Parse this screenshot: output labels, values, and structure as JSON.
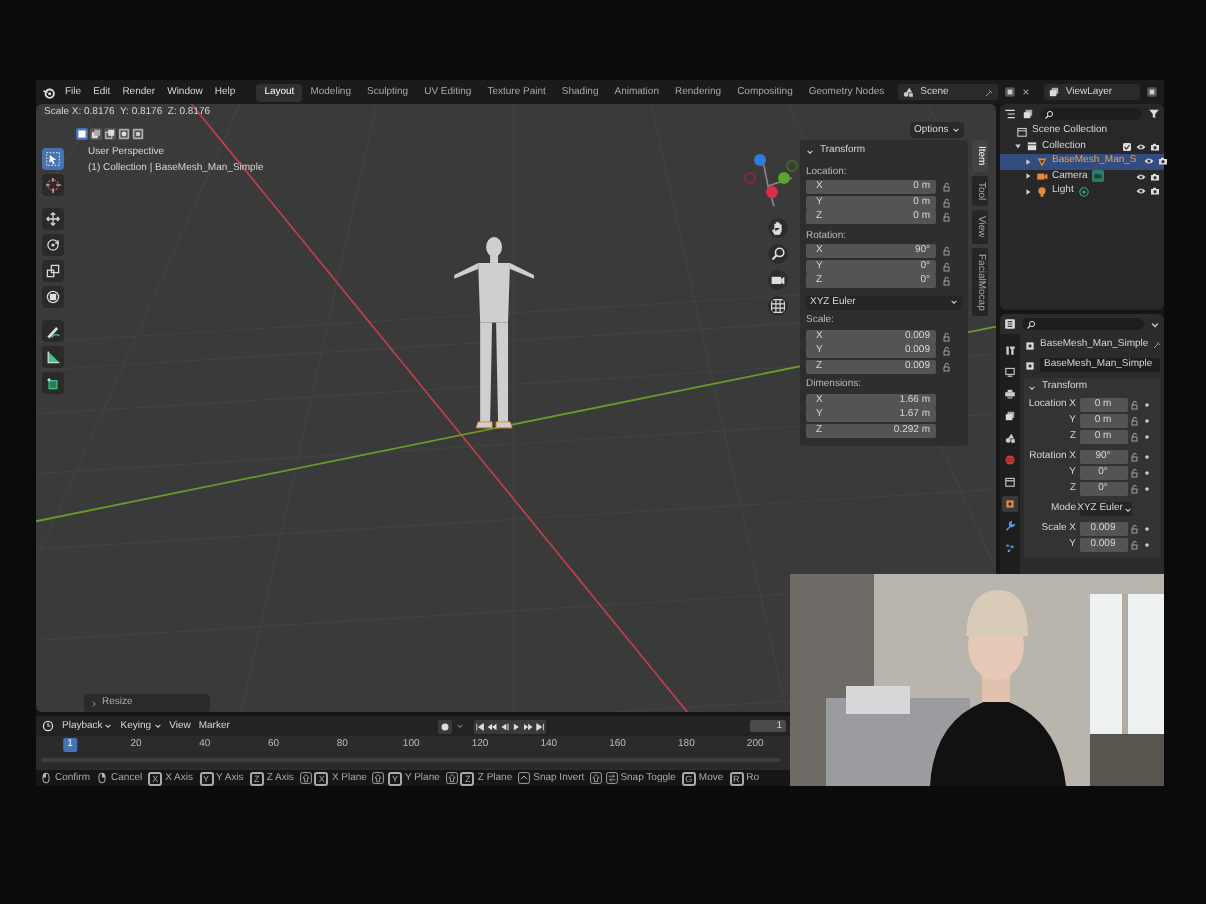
{
  "menu": [
    "File",
    "Edit",
    "Render",
    "Window",
    "Help"
  ],
  "workspaces": [
    {
      "label": "Layout",
      "selected": true
    },
    {
      "label": "Modeling",
      "selected": false
    },
    {
      "label": "Sculpting",
      "selected": false
    },
    {
      "label": "UV Editing",
      "selected": false
    },
    {
      "label": "Texture Paint",
      "selected": false
    },
    {
      "label": "Shading",
      "selected": false
    },
    {
      "label": "Animation",
      "selected": false
    },
    {
      "label": "Rendering",
      "selected": false
    },
    {
      "label": "Compositing",
      "selected": false
    },
    {
      "label": "Geometry Nodes",
      "selected": false
    }
  ],
  "scene": {
    "value": "Scene"
  },
  "view_layer": {
    "value": "ViewLayer"
  },
  "viewport": {
    "operator_info": "Scale X: 0.8176  Y: 0.8176  Z: 0.8176",
    "select_modes": [
      {
        "kind": "set",
        "selected": true
      },
      {
        "kind": "extend",
        "selected": false
      },
      {
        "kind": "subtract",
        "selected": false
      },
      {
        "kind": "invert",
        "selected": false
      },
      {
        "kind": "intersect",
        "selected": false
      }
    ],
    "view_name": "User Perspective",
    "view_context": "(1) Collection | BaseMesh_Man_Simple",
    "tools": [
      {
        "kind": "select",
        "selected": true
      },
      {
        "kind": "cursor",
        "selected": false
      },
      {
        "kind": "move",
        "selected": false
      },
      {
        "kind": "rotate",
        "selected": false
      },
      {
        "kind": "scale",
        "selected": false
      },
      {
        "kind": "transform",
        "selected": false
      },
      {
        "kind": "annotate",
        "selected": false
      },
      {
        "kind": "measure",
        "selected": false
      },
      {
        "kind": "add-cube",
        "selected": false
      }
    ],
    "options_button": "Options",
    "last_operator": "Resize",
    "sidebar_tabs": [
      {
        "label": "Item",
        "selected": true
      },
      {
        "label": "Tool",
        "selected": false
      },
      {
        "label": "View",
        "selected": false
      },
      {
        "label": "FacialMocap",
        "selected": false
      }
    ],
    "transform_panel": {
      "title": "Transform",
      "groups": [
        {
          "label": "Location:",
          "kind": "lockable",
          "fields": [
            {
              "axis": "X",
              "value": "0 m"
            },
            {
              "axis": "Y",
              "value": "0 m"
            },
            {
              "axis": "Z",
              "value": "0 m"
            }
          ]
        },
        {
          "label": "Rotation:",
          "kind": "lockable",
          "fields": [
            {
              "axis": "X",
              "value": "90°"
            },
            {
              "axis": "Y",
              "value": "0°"
            },
            {
              "axis": "Z",
              "value": "0°"
            }
          ],
          "mode": "XYZ Euler"
        },
        {
          "label": "Scale:",
          "kind": "lockable",
          "fields": [
            {
              "axis": "X",
              "value": "0.009"
            },
            {
              "axis": "Y",
              "value": "0.009"
            },
            {
              "axis": "Z",
              "value": "0.009"
            }
          ]
        },
        {
          "label": "Dimensions:",
          "kind": "plain",
          "fields": [
            {
              "axis": "X",
              "value": "1.66 m"
            },
            {
              "axis": "Y",
              "value": "1.67 m"
            },
            {
              "axis": "Z",
              "value": "0.292 m"
            }
          ]
        }
      ]
    }
  },
  "timeline": {
    "menus": [
      {
        "label": "Playback",
        "dropdown": true
      },
      {
        "label": "Keying",
        "dropdown": true
      },
      {
        "label": "View",
        "dropdown": false
      },
      {
        "label": "Marker",
        "dropdown": false
      }
    ],
    "current_frame": "1",
    "ruler": [
      {
        "label": "1",
        "selected": true
      },
      {
        "label": "20",
        "selected": false
      },
      {
        "label": "40",
        "selected": false
      },
      {
        "label": "60",
        "selected": false
      },
      {
        "label": "80",
        "selected": false
      },
      {
        "label": "100",
        "selected": false
      },
      {
        "label": "120",
        "selected": false
      },
      {
        "label": "140",
        "selected": false
      },
      {
        "label": "160",
        "selected": false
      },
      {
        "label": "180",
        "selected": false
      },
      {
        "label": "200",
        "selected": false
      }
    ]
  },
  "status_bar": [
    {
      "label": "Confirm",
      "keys": [
        {
          "kind": "mouse-left"
        }
      ]
    },
    {
      "label": "Cancel",
      "keys": [
        {
          "kind": "mouse-right"
        }
      ]
    },
    {
      "label": "X Axis",
      "keys": [
        {
          "kind": "key",
          "text": "X"
        }
      ]
    },
    {
      "label": "Y Axis",
      "keys": [
        {
          "kind": "key",
          "text": "Y"
        }
      ]
    },
    {
      "label": "Z Axis",
      "keys": [
        {
          "kind": "key",
          "text": "Z"
        }
      ]
    },
    {
      "label": "X Plane",
      "keys": [
        {
          "kind": "shift"
        },
        {
          "kind": "key",
          "text": "X"
        }
      ]
    },
    {
      "label": "Y Plane",
      "keys": [
        {
          "kind": "shift"
        },
        {
          "kind": "key",
          "text": "Y"
        }
      ]
    },
    {
      "label": "Z Plane",
      "keys": [
        {
          "kind": "shift"
        },
        {
          "kind": "key",
          "text": "Z"
        }
      ]
    },
    {
      "label": "Snap Invert",
      "keys": [
        {
          "kind": "ctrl"
        }
      ]
    },
    {
      "label": "Snap Toggle",
      "keys": [
        {
          "kind": "shift"
        },
        {
          "kind": "tab"
        }
      ]
    },
    {
      "label": "Move",
      "keys": [
        {
          "kind": "key",
          "text": "G"
        }
      ]
    },
    {
      "label": "Ro",
      "keys": [
        {
          "kind": "key",
          "text": "R"
        }
      ]
    }
  ],
  "outliner": {
    "items": [
      {
        "name": "Scene Collection",
        "kind": "scene-collection",
        "selected": false,
        "children": [
          {
            "name": "Collection",
            "kind": "collection",
            "selected": false,
            "expanded": true,
            "children": [
              {
                "name": "BaseMesh_Man_S",
                "kind": "mesh",
                "selected": true,
                "expanded": false
              },
              {
                "name": "Camera",
                "kind": "camera",
                "selected": false,
                "expanded": false
              },
              {
                "name": "Light",
                "kind": "light",
                "selected": false,
                "expanded": false
              }
            ]
          }
        ]
      }
    ]
  },
  "properties": {
    "tabs": [
      {
        "kind": "tool",
        "selected": false
      },
      {
        "kind": "render",
        "selected": false
      },
      {
        "kind": "output",
        "selected": false
      },
      {
        "kind": "view-layer",
        "selected": false
      },
      {
        "kind": "scene",
        "selected": false
      },
      {
        "kind": "world",
        "selected": false
      },
      {
        "kind": "collection",
        "selected": false
      },
      {
        "kind": "object",
        "selected": true
      },
      {
        "kind": "modifier",
        "selected": false
      },
      {
        "kind": "particles",
        "selected": false
      }
    ],
    "object_name": "BaseMesh_Man_Simple",
    "data_name": "BaseMesh_Man_Simple",
    "panel": {
      "title": "Transform",
      "rows": [
        {
          "label": "Location X",
          "value": "0 m",
          "kind": "number"
        },
        {
          "label": "Y",
          "value": "0 m",
          "kind": "number"
        },
        {
          "label": "Z",
          "value": "0 m",
          "kind": "number"
        },
        {
          "label": "Rotation X",
          "value": "90°",
          "kind": "number"
        },
        {
          "label": "Y",
          "value": "0°",
          "kind": "number"
        },
        {
          "label": "Z",
          "value": "0°",
          "kind": "number"
        },
        {
          "label": "Mode",
          "value": "XYZ Euler",
          "kind": "dropdown"
        },
        {
          "label": "Scale X",
          "value": "0.009",
          "kind": "number"
        },
        {
          "label": "Y",
          "value": "0.009",
          "kind": "number"
        }
      ]
    }
  }
}
